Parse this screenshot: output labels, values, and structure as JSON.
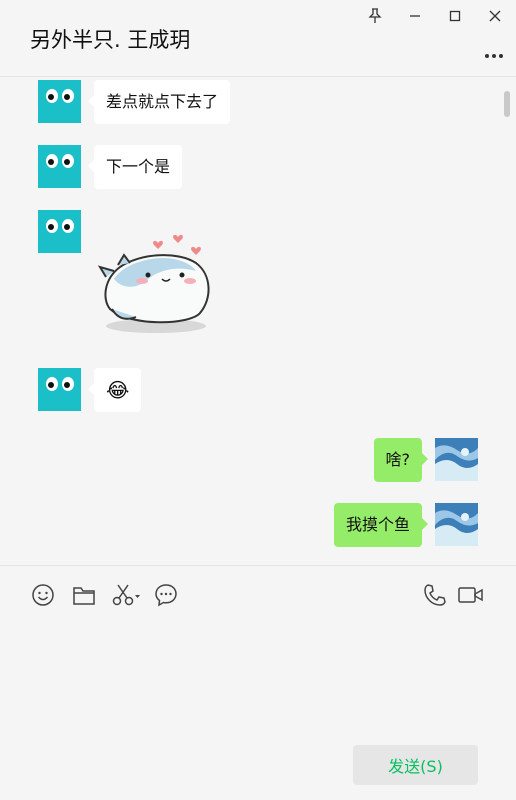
{
  "window": {
    "title": "另外半只. 王成玥",
    "controls": [
      "pin-icon",
      "minimize-icon",
      "maximize-icon",
      "close-icon"
    ],
    "more_icon": "more-icon"
  },
  "messages": [
    {
      "direction": "in",
      "type": "text",
      "text": "差点就点下去了"
    },
    {
      "direction": "in",
      "type": "text",
      "text": "下一个是"
    },
    {
      "direction": "in",
      "type": "sticker",
      "sticker": "cute-shark-sticker"
    },
    {
      "direction": "in",
      "type": "emoji",
      "emoji": "😂"
    },
    {
      "direction": "out",
      "type": "text",
      "text": "啥?"
    },
    {
      "direction": "out",
      "type": "text",
      "text": "我摸个鱼"
    }
  ],
  "toolbar": {
    "left": [
      "emoji-icon",
      "folder-icon",
      "scissors-icon",
      "chat-history-icon"
    ],
    "right": [
      "phone-icon",
      "video-icon"
    ]
  },
  "input": {
    "value": "",
    "send_label": "发送(S)"
  },
  "colors": {
    "background": "#f5f5f5",
    "incoming_bubble": "#ffffff",
    "outgoing_bubble": "#95ec69",
    "send_text": "#07c160",
    "avatar_teal": "#1bbfc8"
  }
}
